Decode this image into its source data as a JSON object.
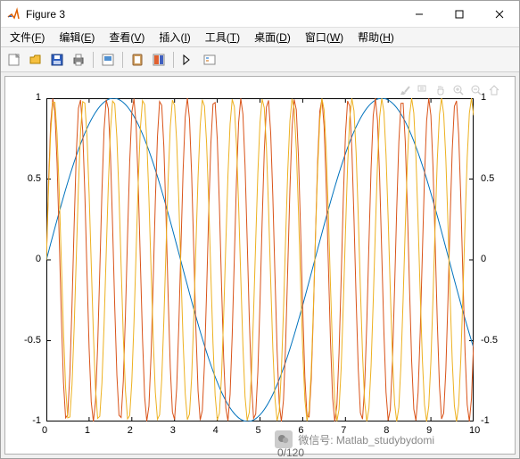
{
  "window": {
    "title": "Figure 3",
    "controls": {
      "min": "min",
      "max": "max",
      "close": "close"
    }
  },
  "menu": {
    "items": [
      {
        "label": "文件",
        "accel": "F"
      },
      {
        "label": "编辑",
        "accel": "E"
      },
      {
        "label": "查看",
        "accel": "V"
      },
      {
        "label": "插入",
        "accel": "I"
      },
      {
        "label": "工具",
        "accel": "T"
      },
      {
        "label": "桌面",
        "accel": "D"
      },
      {
        "label": "窗口",
        "accel": "W"
      },
      {
        "label": "帮助",
        "accel": "H"
      }
    ]
  },
  "toolbar": {
    "new": "new",
    "open": "open",
    "save": "save",
    "print": "print",
    "print_preview": "print-preview",
    "link": "link",
    "inspector": "inspector",
    "cursor": "cursor",
    "legend": "legend"
  },
  "plot_tools": {
    "brush": "brush",
    "datatip": "datatip",
    "pan": "pan",
    "zoomin": "zoom-in",
    "zoomout": "zoom-out",
    "home": "home"
  },
  "axes": {
    "x_ticks": [
      "0",
      "1",
      "2",
      "3",
      "4",
      "5",
      "6",
      "7",
      "8",
      "9",
      "10"
    ],
    "y_left_ticks": [
      "-1",
      "-0.5",
      "0",
      "0.5",
      "1"
    ],
    "y_right_ticks": [
      "-1",
      "-0.5",
      "0",
      "0.5",
      "1"
    ]
  },
  "watermark": {
    "label": "微信号: Matlab_studybydomi"
  },
  "footer_fragment": "0/120",
  "left_fragments": [
    "",
    "",
    ""
  ],
  "chart_data": {
    "type": "line",
    "xlim": [
      0,
      10
    ],
    "ylim_left": [
      -1,
      1
    ],
    "ylim_right": [
      -1,
      1
    ],
    "x_step": 0.05,
    "series": [
      {
        "name": "sin(x)",
        "axis": "left",
        "color": "#0072BD",
        "formula": "sin(x)"
      },
      {
        "name": "sin(10x)",
        "axis": "right",
        "color": "#D95319",
        "formula": "sin(10*x)"
      },
      {
        "name": "sin(9x)",
        "axis": "right",
        "color": "#EDB120",
        "formula": "sin(9*x)"
      }
    ]
  }
}
